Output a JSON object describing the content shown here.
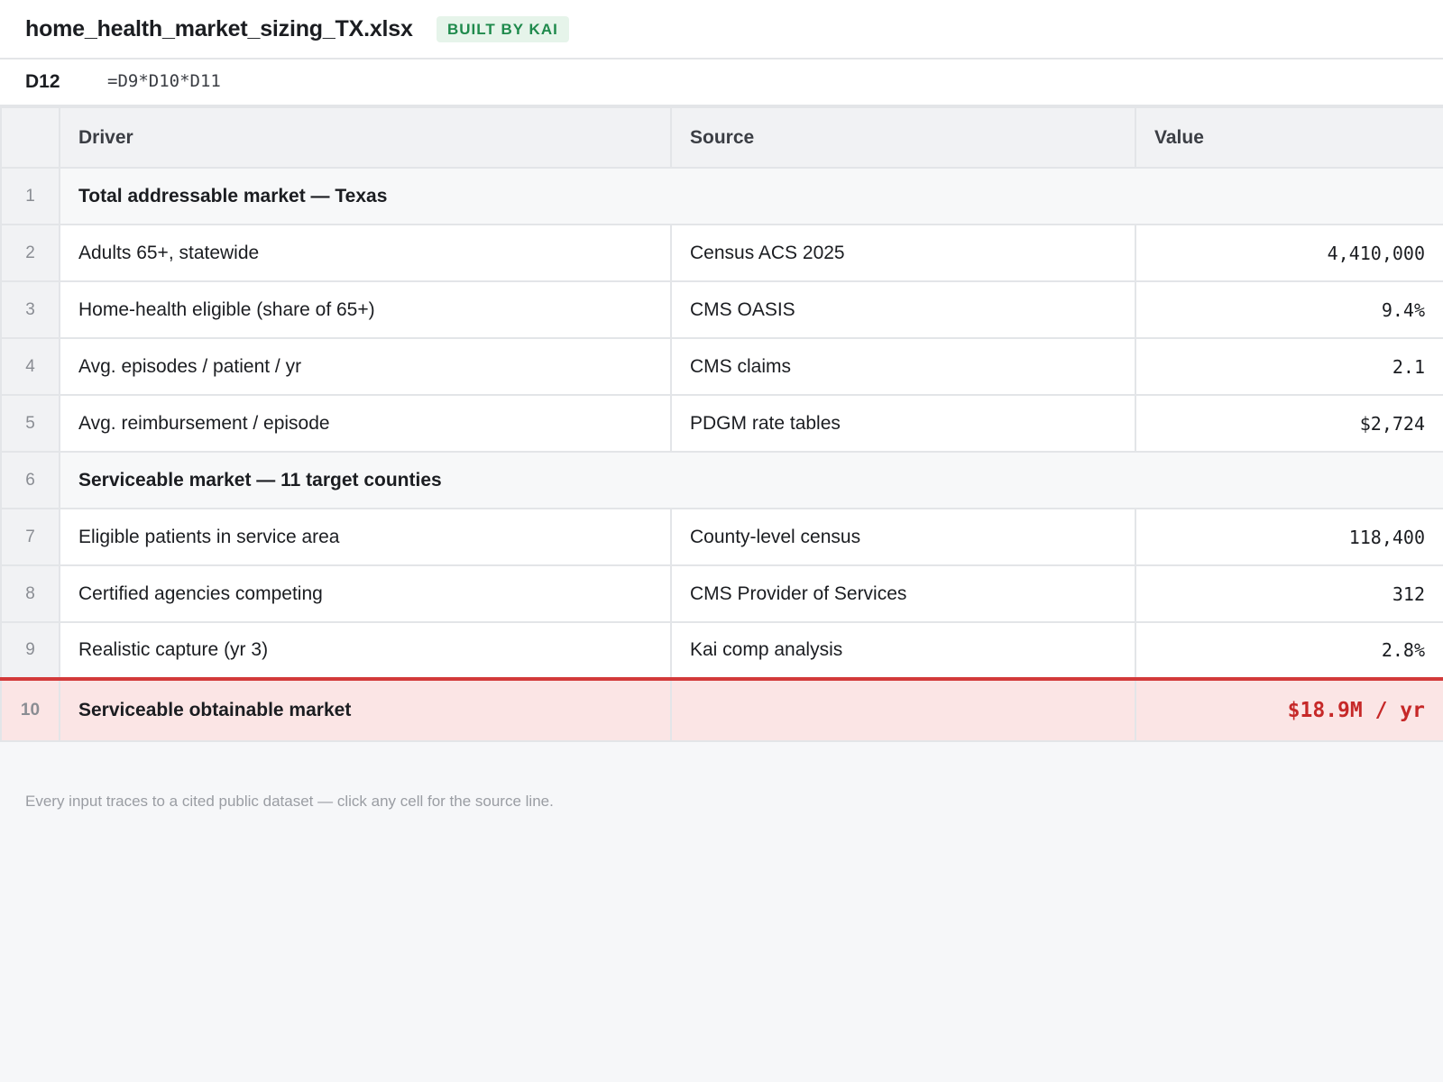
{
  "titlebar": {
    "filename": "home_health_market_sizing_TX.xlsx",
    "badge": "BUILT BY KAI"
  },
  "formula_bar": {
    "cell_ref": "D12",
    "formula": "=D9*D10*D11"
  },
  "table": {
    "headers": [
      "Driver",
      "Source",
      "Value"
    ],
    "rows": [
      {
        "num": "1",
        "type": "section",
        "driver": "Total addressable market — Texas"
      },
      {
        "num": "2",
        "type": "data",
        "driver": "Adults 65+, statewide",
        "source": "Census ACS 2025",
        "value": "4,410,000"
      },
      {
        "num": "3",
        "type": "data",
        "driver": "Home-health eligible (share of 65+)",
        "source": "CMS OASIS",
        "value": "9.4%"
      },
      {
        "num": "4",
        "type": "data",
        "driver": "Avg. episodes / patient / yr",
        "source": "CMS claims",
        "value": "2.1"
      },
      {
        "num": "5",
        "type": "data",
        "driver": "Avg. reimbursement / episode",
        "source": "PDGM rate tables",
        "value": "$2,724"
      },
      {
        "num": "6",
        "type": "section",
        "driver": "Serviceable market — 11 target counties"
      },
      {
        "num": "7",
        "type": "data",
        "driver": "Eligible patients in service area",
        "source": "County-level census",
        "value": "118,400"
      },
      {
        "num": "8",
        "type": "data",
        "driver": "Certified agencies competing",
        "source": "CMS Provider of Services",
        "value": "312"
      },
      {
        "num": "9",
        "type": "data",
        "driver": "Realistic capture (yr 3)",
        "source": "Kai comp analysis",
        "value": "2.8%"
      },
      {
        "num": "10",
        "type": "total",
        "driver": "Serviceable obtainable market",
        "source": "",
        "value": "$18.9M / yr"
      }
    ]
  },
  "footnote": "Every input traces to a cited public dataset — click any cell for the source line.",
  "colors": {
    "badge_bg": "#e6f4ea",
    "badge_text": "#1f8a4c",
    "total_bg": "#fbe5e5",
    "total_accent": "#d33a3a",
    "total_value": "#c62828"
  }
}
